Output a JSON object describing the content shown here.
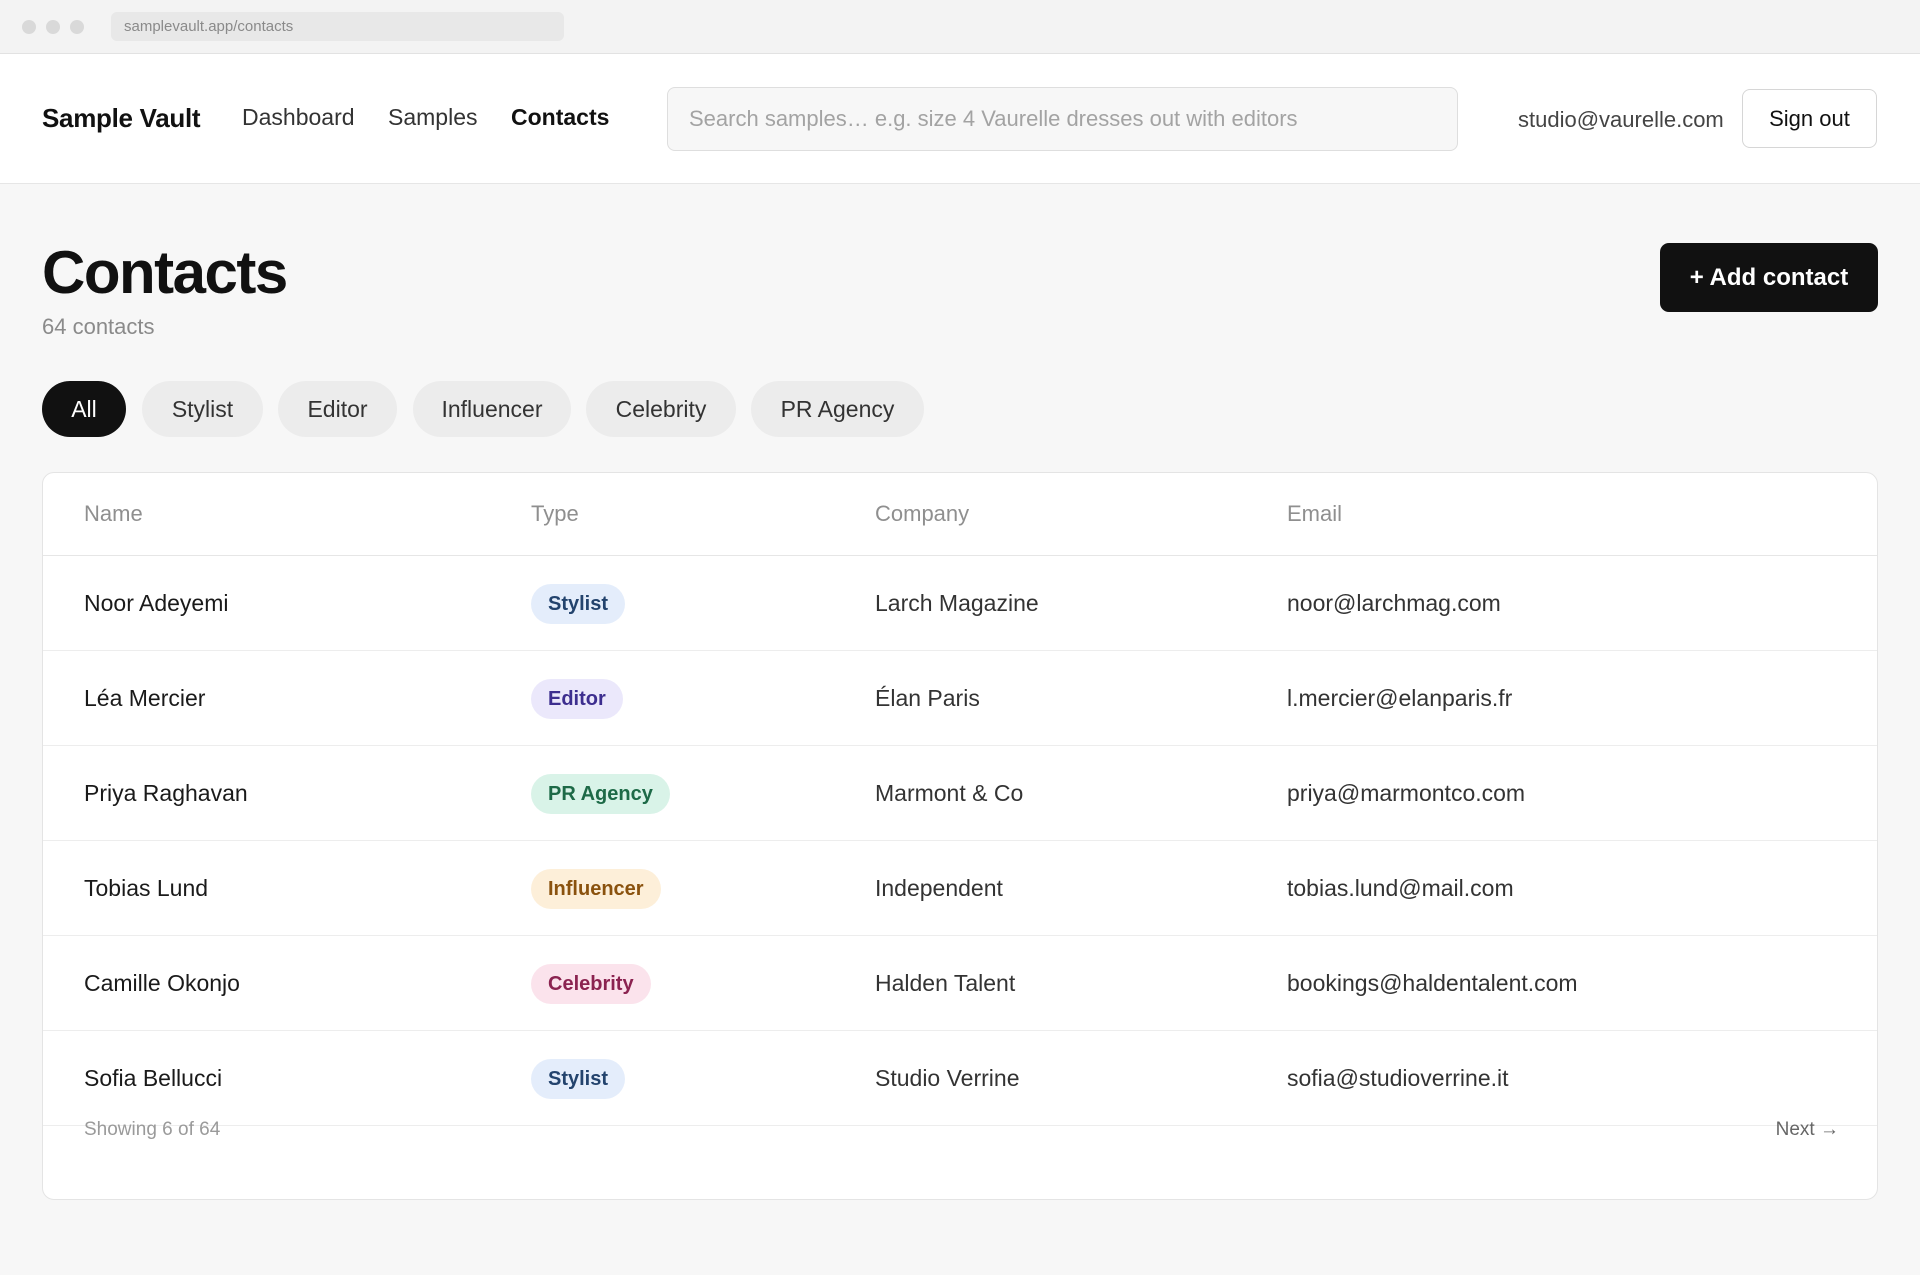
{
  "browser": {
    "url": "samplevault.app/contacts"
  },
  "nav": {
    "brand": "Sample Vault",
    "links": [
      "Dashboard",
      "Samples",
      "Contacts"
    ],
    "search_placeholder": "Search samples… e.g. size 4 Vaurelle dresses out with editors",
    "user_email": "studio@vaurelle.com",
    "signout_label": "Sign out"
  },
  "header": {
    "title": "Contacts",
    "count": "64 contacts",
    "add_label": "+ Add contact"
  },
  "filters": [
    "All",
    "Stylist",
    "Editor",
    "Influencer",
    "Celebrity",
    "PR Agency"
  ],
  "table": {
    "columns": [
      "Name",
      "Type",
      "Company",
      "Email"
    ],
    "rows": [
      {
        "name": "Noor Adeyemi",
        "type": "Stylist",
        "company": "Larch Magazine",
        "email": "noor@larchmag.com"
      },
      {
        "name": "Léa Mercier",
        "type": "Editor",
        "company": "Élan Paris",
        "email": "l.mercier@elanparis.fr"
      },
      {
        "name": "Priya Raghavan",
        "type": "PR Agency",
        "company": "Marmont & Co",
        "email": "priya@marmontco.com"
      },
      {
        "name": "Tobias Lund",
        "type": "Influencer",
        "company": "Independent",
        "email": "tobias.lund@mail.com"
      },
      {
        "name": "Camille Okonjo",
        "type": "Celebrity",
        "company": "Halden Talent",
        "email": "bookings@haldentalent.com"
      },
      {
        "name": "Sofia Bellucci",
        "type": "Stylist",
        "company": "Studio Verrine",
        "email": "sofia@studioverrine.it"
      }
    ],
    "footer": "Showing 6 of 64",
    "next_label": "Next →"
  }
}
